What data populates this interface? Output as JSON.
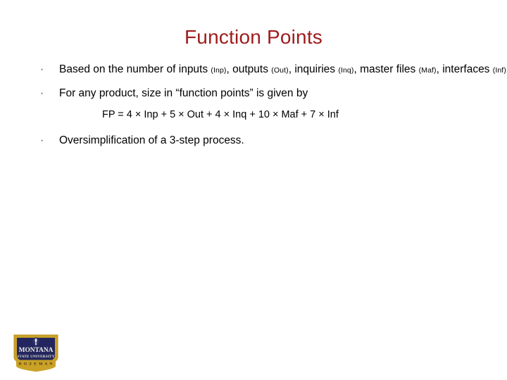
{
  "slide": {
    "title": "Function Points",
    "title_color": "#9e1b1b",
    "background_color": "#ffffff",
    "bullet_marker": "·",
    "bullets": [
      {
        "id": "bullet-inputs",
        "parts": [
          {
            "text": "Based on the number of inputs ",
            "small": false
          },
          {
            "text": "(Inp)",
            "small": true
          },
          {
            "text": ", outputs ",
            "small": false
          },
          {
            "text": "(Out)",
            "small": true
          },
          {
            "text": ", inquiries ",
            "small": false
          },
          {
            "text": "(Inq)",
            "small": true
          },
          {
            "text": ", master files ",
            "small": false
          },
          {
            "text": "(Maf)",
            "small": true
          },
          {
            "text": ", interfaces ",
            "small": false
          },
          {
            "text": "(Inf)",
            "small": true
          }
        ],
        "plain": "Based on the number of inputs (Inp), outputs (Out), inquiries (Inq), master files (Maf), interfaces (Inf)"
      },
      {
        "id": "bullet-function-points",
        "parts": [
          {
            "text": "For any product, size in “function points” is given by",
            "small": false
          }
        ],
        "plain": "For any product, size in “function points” is given by"
      },
      {
        "id": "bullet-oversimplification",
        "parts": [
          {
            "text": "Oversimplification of a 3-step process.",
            "small": false
          }
        ],
        "plain": "Oversimplification of a 3-step process."
      }
    ],
    "formula": "FP = 4 × Inp + 5 × Out + 4 × Inq + 10 × Maf + 7 × Inf"
  },
  "logo": {
    "name": "montana-state-university-logo",
    "line1": "MONTANA",
    "line2": "STATE UNIVERSITY",
    "line3": "B O Z E M A N",
    "shield_color": "#23265e",
    "border_color": "#c9a227",
    "band_color": "#c9a227",
    "band_text_color": "#5c3a12"
  }
}
